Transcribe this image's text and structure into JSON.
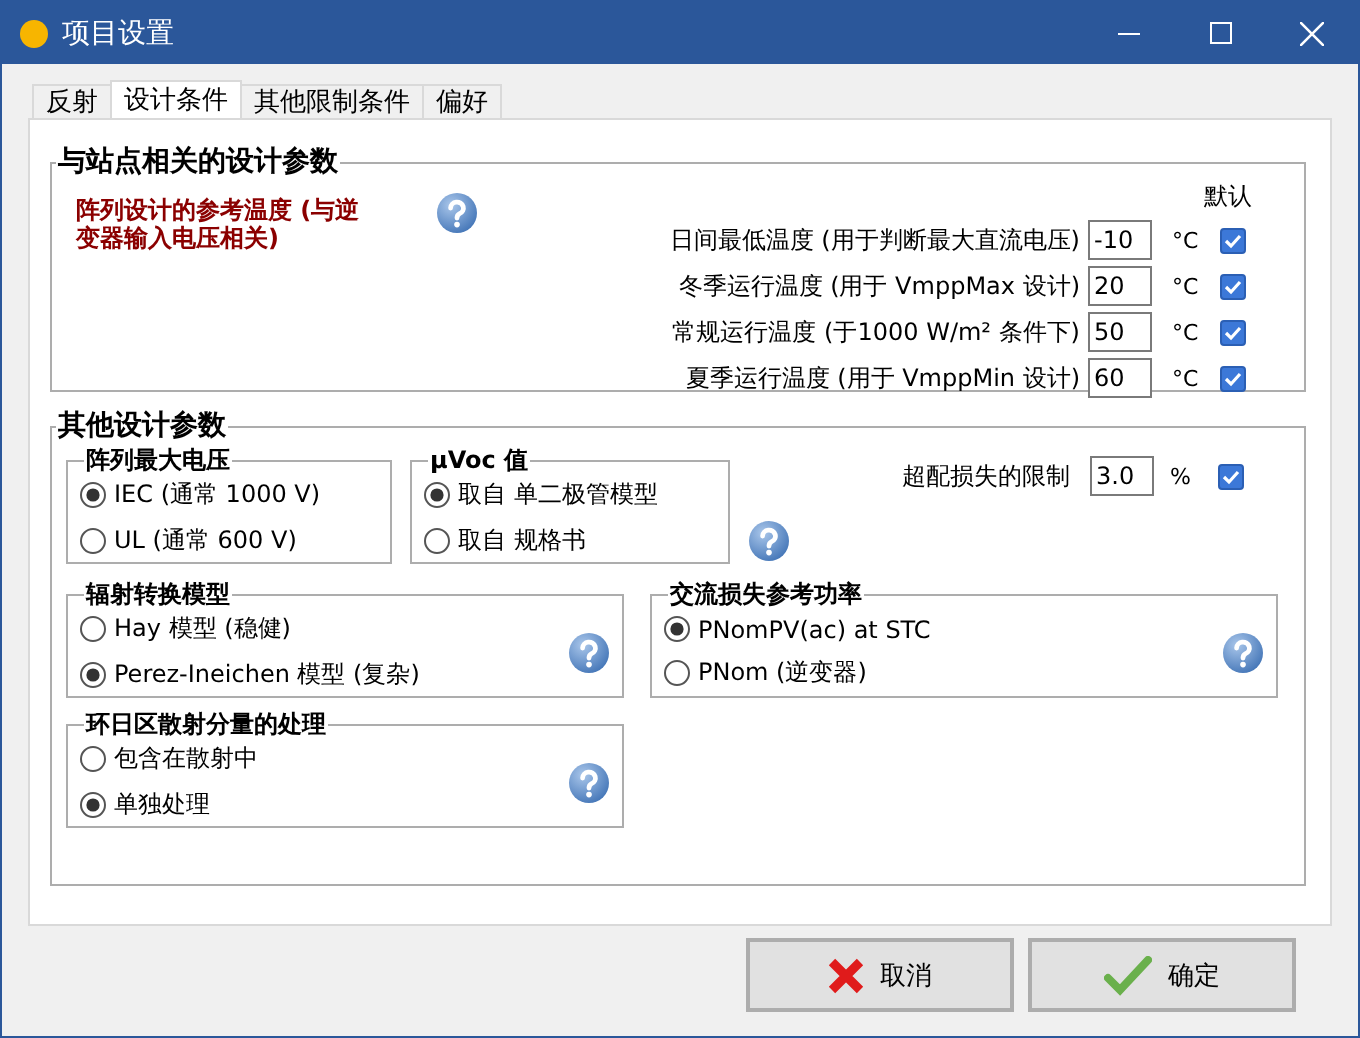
{
  "window": {
    "title": "项目设置"
  },
  "tabs": [
    {
      "label": "反射",
      "selected": false
    },
    {
      "label": "设计条件",
      "selected": true
    },
    {
      "label": "其他限制条件",
      "selected": false
    },
    {
      "label": "偏好",
      "selected": false
    }
  ],
  "site_group": {
    "title": "与站点相关的设计参数",
    "note": "阵列设计的参考温度 (与逆变器输入电压相关)",
    "default_header": "默认",
    "rows": [
      {
        "label": "日间最低温度 (用于判断最大直流电压)",
        "value": "-10",
        "unit": "°C",
        "checked": true
      },
      {
        "label": "冬季运行温度 (用于 VmppMax 设计)",
        "value": "20",
        "unit": "°C",
        "checked": true
      },
      {
        "label": "常规运行温度 (于1000 W/m² 条件下)",
        "value": "50",
        "unit": "°C",
        "checked": true
      },
      {
        "label": "夏季运行温度 (用于 VmppMin 设计)",
        "value": "60",
        "unit": "°C",
        "checked": true
      }
    ]
  },
  "other_group": {
    "title": "其他设计参数",
    "overload": {
      "label": "超配损失的限制",
      "value": "3.0",
      "unit": "%",
      "checked": true
    },
    "groups": [
      {
        "title": "阵列最大电压",
        "help": false,
        "options": [
          {
            "label": "IEC (通常 1000 V)",
            "selected": true
          },
          {
            "label": "UL (通常 600 V)",
            "selected": false
          }
        ]
      },
      {
        "title": "μVoc 值",
        "help": true,
        "options": [
          {
            "label": "取自 单二极管模型",
            "selected": true
          },
          {
            "label": "取自 规格书",
            "selected": false
          }
        ]
      },
      {
        "title": "辐射转换模型",
        "help": true,
        "options": [
          {
            "label": "Hay 模型 (稳健)",
            "selected": false
          },
          {
            "label": "Perez-Ineichen 模型 (复杂)",
            "selected": true
          }
        ]
      },
      {
        "title": "交流损失参考功率",
        "help": true,
        "options": [
          {
            "label": "PNomPV(ac) at STC",
            "selected": true
          },
          {
            "label": "PNom (逆变器)",
            "selected": false
          }
        ]
      },
      {
        "title": "环日区散射分量的处理",
        "help": true,
        "options": [
          {
            "label": "包含在散射中",
            "selected": false
          },
          {
            "label": "单独处理",
            "selected": true
          }
        ]
      }
    ]
  },
  "buttons": [
    {
      "label": "取消",
      "kind": "cancel"
    },
    {
      "label": "确定",
      "kind": "ok"
    }
  ]
}
